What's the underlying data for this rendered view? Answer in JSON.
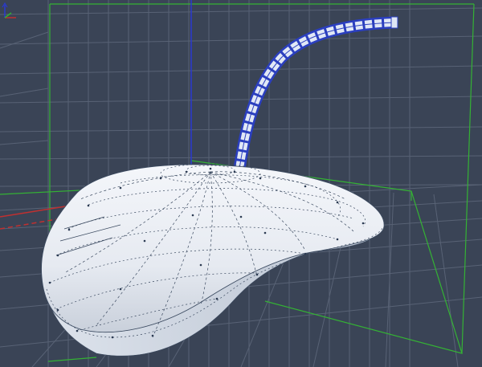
{
  "scene": {
    "background": "#3a4456",
    "grid_color": "#5c6679",
    "axis_colors": {
      "x": "#c03030",
      "y": "#30b030",
      "z": "#2a3ad0"
    },
    "mesh_fill": "#e8ecf3",
    "mesh_edge": "#3b4a60",
    "cable_fill": "#dfe6f5",
    "cable_edge": "#2b3fbf"
  },
  "objects": [
    {
      "name": "mouse-body",
      "type": "subdivision-mesh",
      "selected": false
    },
    {
      "name": "mouse-cable",
      "type": "sweep",
      "selected": true
    }
  ],
  "gizmo": {
    "icon": "axis-gizmo-icon"
  }
}
